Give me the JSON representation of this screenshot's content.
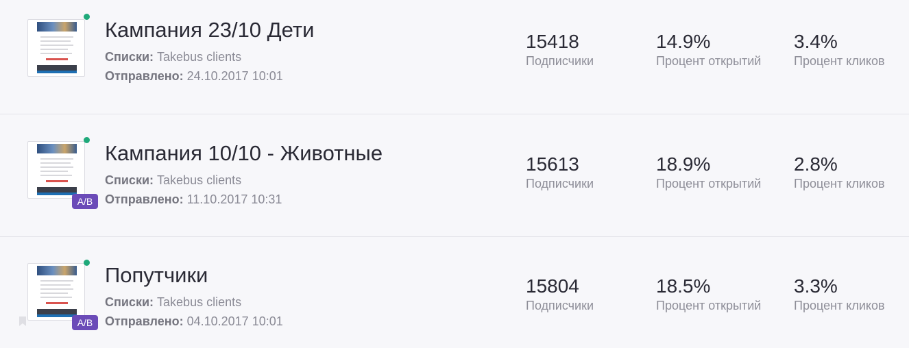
{
  "labels": {
    "lists_key": "Списки:",
    "sent_key": "Отправлено:",
    "subscribers": "Подписчики",
    "open_rate": "Процент открытий",
    "click_rate": "Процент кликов",
    "ab_badge": "A/B"
  },
  "campaigns": [
    {
      "title": "Кампания 23/10 Дети",
      "lists": "Takebus clients",
      "sent": "24.10.2017 10:01",
      "subscribers": "15418",
      "open_rate": "14.9%",
      "click_rate": "3.4%"
    },
    {
      "title": "Кампания 10/10 - Животные",
      "lists": "Takebus clients",
      "sent": "11.10.2017 10:31",
      "subscribers": "15613",
      "open_rate": "18.9%",
      "click_rate": "2.8%"
    },
    {
      "title": "Попутчики",
      "lists": "Takebus clients",
      "sent": "04.10.2017 10:01",
      "subscribers": "15804",
      "open_rate": "18.5%",
      "click_rate": "3.3%"
    }
  ],
  "colors": {
    "status_active": "#1fa97a",
    "ab_badge": "#6b4bb8"
  },
  "icons": {
    "status": "status-dot-icon",
    "bookmark": "bookmark-icon"
  }
}
